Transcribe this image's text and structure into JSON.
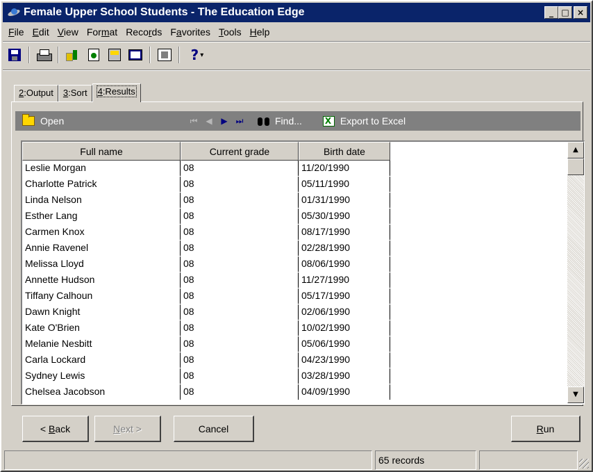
{
  "window": {
    "title": "Female Upper School Students - The Education Edge",
    "controls": {
      "minimize": "_",
      "maximize": "□",
      "close": "×"
    }
  },
  "menu": [
    {
      "pre": "",
      "key": "F",
      "post": "ile"
    },
    {
      "pre": "",
      "key": "E",
      "post": "dit"
    },
    {
      "pre": "",
      "key": "V",
      "post": "iew"
    },
    {
      "pre": "For",
      "key": "m",
      "post": "at"
    },
    {
      "pre": "Reco",
      "key": "r",
      "post": "ds"
    },
    {
      "pre": "F",
      "key": "a",
      "post": "vorites"
    },
    {
      "pre": "",
      "key": "T",
      "post": "ools"
    },
    {
      "pre": "",
      "key": "H",
      "post": "elp"
    }
  ],
  "toolbar": {
    "icons": [
      "save-icon",
      "print-icon",
      "query-icon",
      "refresh-icon",
      "export-icon",
      "monitor-icon",
      "properties-icon",
      "help-icon"
    ],
    "help_glyph": "?",
    "help_arrow": "▾"
  },
  "tabs": [
    {
      "key": "2",
      "label": ":Output",
      "active": false
    },
    {
      "key": "3",
      "label": ":Sort",
      "active": false
    },
    {
      "key": "4",
      "label": ":Results",
      "active": true
    }
  ],
  "results_bar": {
    "open_label": "Open",
    "nav": {
      "first": "⏮",
      "prev": "◀",
      "next": "▶",
      "last": "⏭"
    },
    "find_label": "Find...",
    "export_label": "Export to Excel"
  },
  "grid": {
    "columns": [
      "Full name",
      "Current grade",
      "Birth date"
    ],
    "rows": [
      [
        "Leslie Morgan",
        "08",
        "11/20/1990"
      ],
      [
        "Charlotte Patrick",
        "08",
        "05/11/1990"
      ],
      [
        "Linda Nelson",
        "08",
        "01/31/1990"
      ],
      [
        "Esther Lang",
        "08",
        "05/30/1990"
      ],
      [
        "Carmen Knox",
        "08",
        "08/17/1990"
      ],
      [
        "Annie Ravenel",
        "08",
        "02/28/1990"
      ],
      [
        "Melissa Lloyd",
        "08",
        "08/06/1990"
      ],
      [
        "Annette Hudson",
        "08",
        "11/27/1990"
      ],
      [
        "Tiffany Calhoun",
        "08",
        "05/17/1990"
      ],
      [
        "Dawn Knight",
        "08",
        "02/06/1990"
      ],
      [
        "Kate O'Brien",
        "08",
        "10/02/1990"
      ],
      [
        "Melanie Nesbitt",
        "08",
        "05/06/1990"
      ],
      [
        "Carla Lockard",
        "08",
        "04/23/1990"
      ],
      [
        "Sydney Lewis",
        "08",
        "03/28/1990"
      ],
      [
        "Chelsea Jacobson",
        "08",
        "04/09/1990"
      ]
    ]
  },
  "buttons": {
    "back": {
      "pre": "< ",
      "key": "B",
      "post": "ack"
    },
    "next": {
      "pre": "",
      "key": "N",
      "post": "ext >"
    },
    "cancel": "Cancel",
    "run": {
      "pre": "",
      "key": "R",
      "post": "un"
    }
  },
  "status": {
    "record_count": "65 records"
  },
  "colors": {
    "titlebar": "#0a246a",
    "face": "#d4d0c8",
    "results_bar": "#808080"
  }
}
